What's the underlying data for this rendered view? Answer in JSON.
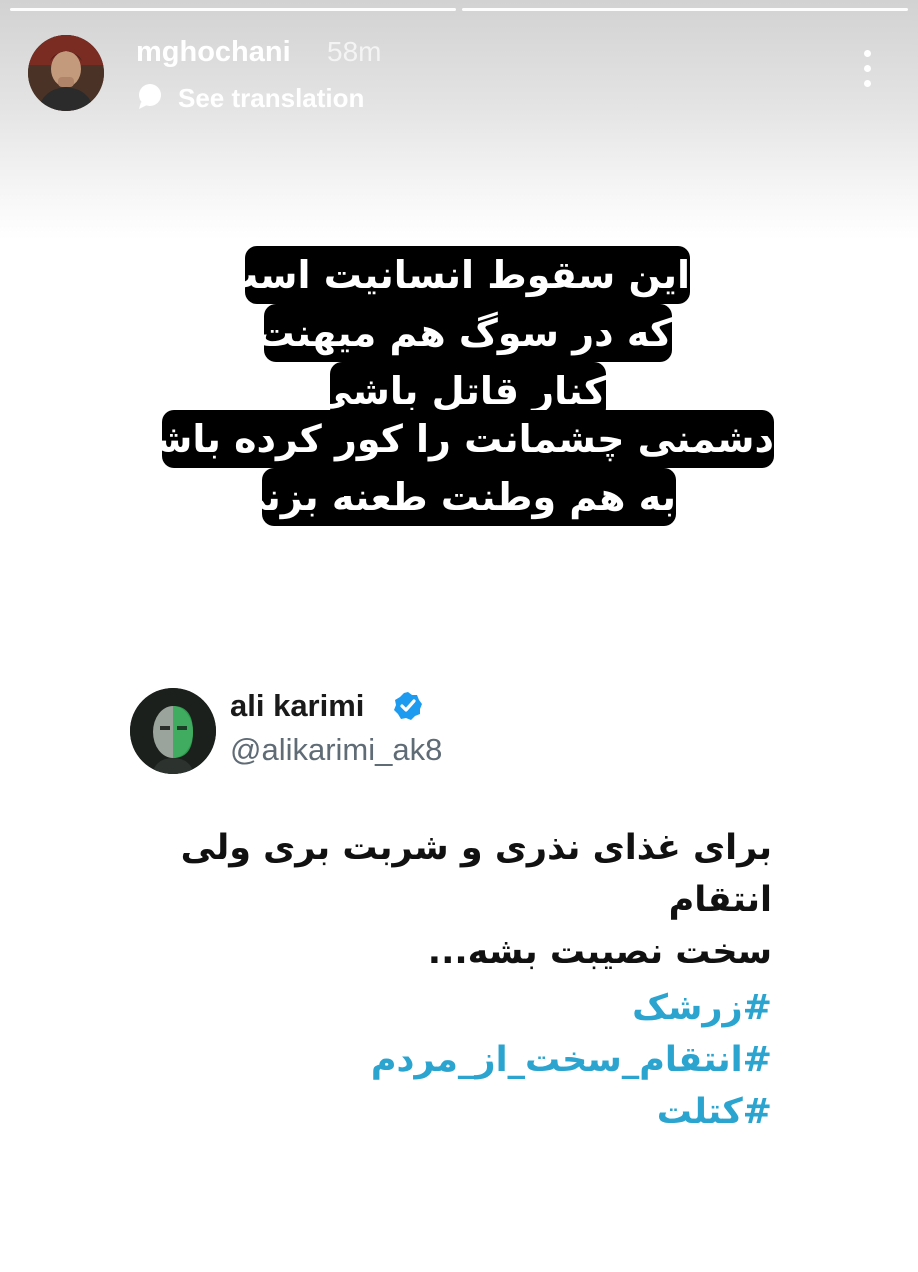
{
  "story": {
    "username": "mghochani",
    "time_ago": "58m",
    "see_translation": "See translation",
    "caption_lines": [
      "این سقوط انسانیت است",
      "که در سوگ  هم میهنت",
      "کنار قاتل باشی",
      "دشمنی چشمانت را کور کرده باشد",
      "به هم وطنت طعنه بزنی"
    ]
  },
  "tweet": {
    "name": "ali karimi",
    "handle": "@alikarimi_ak8",
    "text_line1": "برای غذای نذری و شربت بری ولی انتقام",
    "text_line2": "سخت نصیبت بشه...",
    "hashtags": [
      "#زرشک",
      "#انتقام_سخت_از_مردم",
      "#کتلت"
    ]
  },
  "icons": {
    "menu": "more-vertical-icon",
    "translate": "speech-bubble-icon",
    "verified": "verified-badge-icon"
  },
  "colors": {
    "hashtag": "#2ba4cf",
    "verified": "#1d9bf0",
    "caption_bg": "#000000"
  }
}
